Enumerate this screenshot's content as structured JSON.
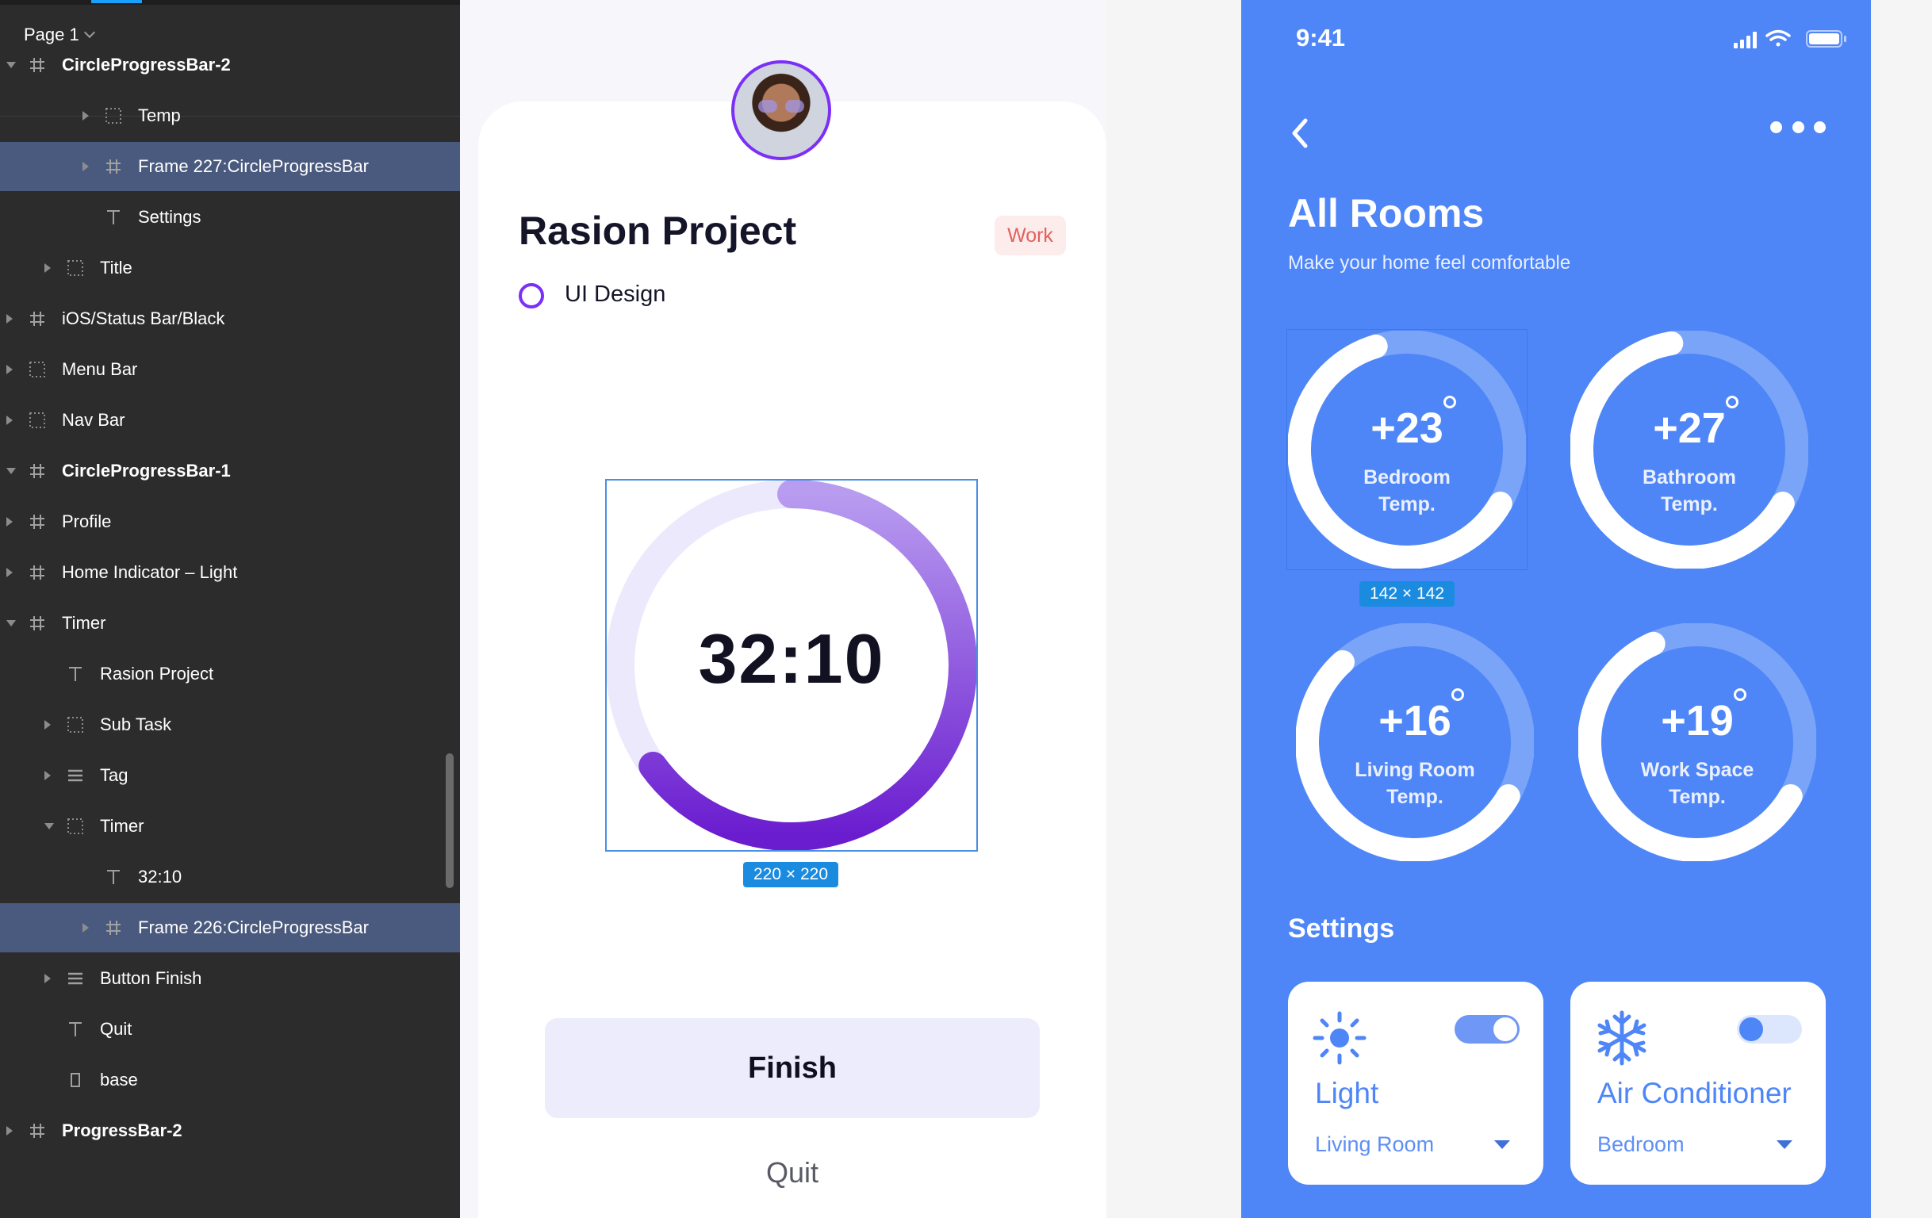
{
  "layers_panel": {
    "page_selector": "Page 1",
    "rows": [
      {
        "label": "CircleProgressBar-2",
        "icon": "frame-icon",
        "bold": true,
        "caret": "down"
      },
      {
        "label": "Temp",
        "icon": "group-icon",
        "caret": "right"
      },
      {
        "label": "Frame 227:CircleProgressBar",
        "icon": "frame-icon",
        "caret": "right",
        "selected": true
      },
      {
        "label": "Settings",
        "icon": "text-icon"
      },
      {
        "label": "Title",
        "icon": "group-icon",
        "caret": "right"
      },
      {
        "label": "iOS/Status Bar/Black",
        "icon": "frame-icon",
        "caret": "right"
      },
      {
        "label": "Menu Bar",
        "icon": "group-icon",
        "caret": "right"
      },
      {
        "label": "Nav Bar",
        "icon": "group-icon",
        "caret": "right"
      },
      {
        "label": "CircleProgressBar-1",
        "icon": "frame-icon",
        "bold": true,
        "caret": "down"
      },
      {
        "label": "Profile",
        "icon": "frame-icon",
        "caret": "right"
      },
      {
        "label": "Home Indicator – Light",
        "icon": "frame-icon",
        "caret": "right"
      },
      {
        "label": "Timer",
        "icon": "frame-icon",
        "caret": "down"
      },
      {
        "label": "Rasion Project",
        "icon": "text-icon"
      },
      {
        "label": "Sub Task",
        "icon": "group-icon",
        "caret": "right"
      },
      {
        "label": "Tag",
        "icon": "autolayout-icon",
        "caret": "right"
      },
      {
        "label": "Timer",
        "icon": "group-icon",
        "caret": "down"
      },
      {
        "label": "32:10",
        "icon": "text-icon"
      },
      {
        "label": "Frame 226:CircleProgressBar",
        "icon": "frame-icon",
        "caret": "right",
        "selected": true
      },
      {
        "label": "Button Finish",
        "icon": "autolayout-icon",
        "caret": "right"
      },
      {
        "label": "Quit",
        "icon": "text-icon"
      },
      {
        "label": "base",
        "icon": "rectangle-icon"
      },
      {
        "label": "ProgressBar-2",
        "icon": "frame-icon",
        "bold": true,
        "caret": "right"
      }
    ]
  },
  "timer_screen": {
    "project_title": "Rasion Project",
    "tag": "Work",
    "subtask": "UI Design",
    "timer_value": "32:10",
    "progress": 0.65,
    "selection_size": "220 × 220",
    "finish_label": "Finish",
    "quit_label": "Quit",
    "colors": {
      "ring_track": "#ebe9fb",
      "ring_start": "#b89cf0",
      "ring_end": "#6a1ccf",
      "accent": "#7b2ff7"
    }
  },
  "rooms_screen": {
    "status_time": "9:41",
    "title": "All Rooms",
    "subtitle": "Make your home feel comfortable",
    "selection_size": "142 × 142",
    "rooms": [
      {
        "value": "+23",
        "label_line1": "Bedroom",
        "label_line2": "Temp.",
        "progress": 0.62
      },
      {
        "value": "+27",
        "label_line1": "Bathroom",
        "label_line2": "Temp.",
        "progress": 0.64
      },
      {
        "value": "+16",
        "label_line1": "Living Room",
        "label_line2": "Temp.",
        "progress": 0.55
      },
      {
        "value": "+19",
        "label_line1": "Work Space",
        "label_line2": "Temp.",
        "progress": 0.6
      }
    ],
    "settings_title": "Settings",
    "devices": [
      {
        "name": "Light",
        "room": "Living Room",
        "icon": "sun-icon",
        "on": true
      },
      {
        "name": "Air Conditioner",
        "room": "Bedroom",
        "icon": "snowflake-icon",
        "on": false
      }
    ],
    "colors": {
      "background": "#4f86f7",
      "track": "#7aa4f8",
      "progress": "#ffffff"
    }
  }
}
